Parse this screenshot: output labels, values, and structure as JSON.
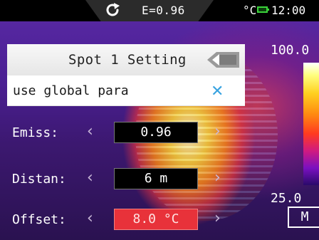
{
  "status_bar": {
    "emissivity": "E=0.96",
    "unit": "°C",
    "time": "12:00",
    "refresh_icon": "refresh-icon",
    "battery_icon": "battery-icon",
    "battery_color": "#3bd43b"
  },
  "scale": {
    "max": "100.0",
    "min": "25.0",
    "mode": "M"
  },
  "dialog": {
    "title": "Spot 1 Setting",
    "global_option": "use global para",
    "close_icon": "close-icon",
    "back_icon": "back-arrow-icon",
    "accent_color": "#39a3e0",
    "rows": [
      {
        "label": "Emiss:",
        "value": "0.96"
      },
      {
        "label": "Distan:",
        "value": "6 m"
      },
      {
        "label": "Offset:",
        "value": "8.0 °C",
        "selected": true
      }
    ],
    "left_arrow": "‹",
    "right_arrow": "›"
  },
  "colors": {
    "selected_value_bg": "#e8323a"
  }
}
